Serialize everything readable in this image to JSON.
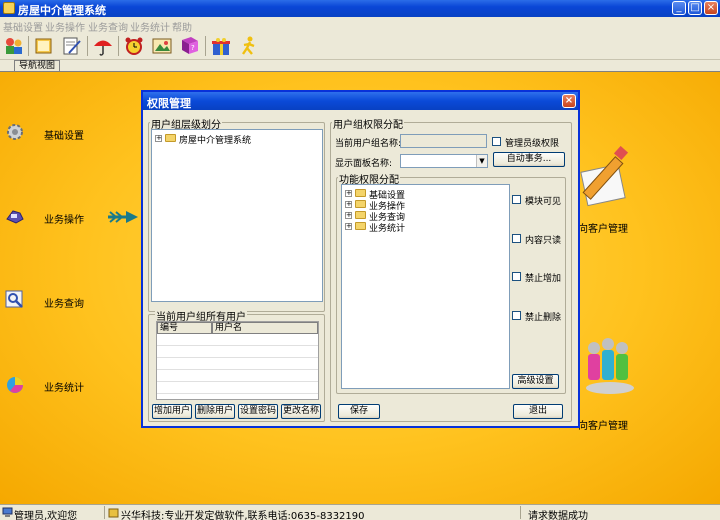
{
  "window": {
    "title": "房屋中介管理系统",
    "controls": [
      "_",
      "□",
      "×"
    ]
  },
  "menu": [
    "基础设置",
    "业务操作",
    "业务查询",
    "业务统计",
    "帮助"
  ],
  "toolbar": {
    "icons": [
      "users-icon",
      "book-icon",
      "notepad-icon",
      "umbrella-icon",
      "alarm-clock-icon",
      "picture-icon",
      "help-book-icon",
      "gift-icon",
      "running-man-icon"
    ]
  },
  "nav": {
    "tab_label": "导航视图"
  },
  "sidebar": {
    "items": [
      {
        "label": "基础设置",
        "icon": "gear-icon"
      },
      {
        "label": "业务操作",
        "icon": "hand-icon"
      },
      {
        "label": "业务查询",
        "icon": "magnifier-icon"
      },
      {
        "label": "业务统计",
        "icon": "pie-chart-icon"
      }
    ]
  },
  "workspace": {
    "labels": [
      "向客户管理",
      "向客户管理"
    ]
  },
  "dialog": {
    "title": "权限管理",
    "close": "×",
    "left": {
      "group_title": "用户组层级划分",
      "tree": [
        {
          "label": "房屋中介管理系统",
          "expander": "+"
        }
      ],
      "users_group_title": "当前用户组所有用户",
      "grid_columns": [
        "编号",
        "用户名"
      ],
      "buttons": [
        "增加用户",
        "删除用户",
        "设置密码",
        "更改名称"
      ]
    },
    "right": {
      "group_title": "用户组权限分配",
      "current_group_label": "当前用户组名称:",
      "current_group_value": "",
      "admin_checkbox_label": "管理员级权限",
      "panel_name_label": "显示面板名称:",
      "panel_name_value": "",
      "auto_button": "自动事务...",
      "func_group_title": "功能权限分配",
      "func_tree": [
        {
          "label": "基础设置",
          "expander": "+"
        },
        {
          "label": "业务操作",
          "expander": "+"
        },
        {
          "label": "业务查询",
          "expander": "+"
        },
        {
          "label": "业务统计",
          "expander": "+"
        }
      ],
      "checkboxes": [
        "模块可见",
        "内容只读",
        "禁止增加",
        "禁止删除"
      ],
      "advanced_button": "高级设置",
      "save_button": "保存",
      "exit_button": "退出"
    }
  },
  "status": {
    "user": "管理员,欢迎您",
    "company": "兴华科技:专业开发定做软件,联系电话:0635-8332190",
    "message": "请求数据成功"
  }
}
